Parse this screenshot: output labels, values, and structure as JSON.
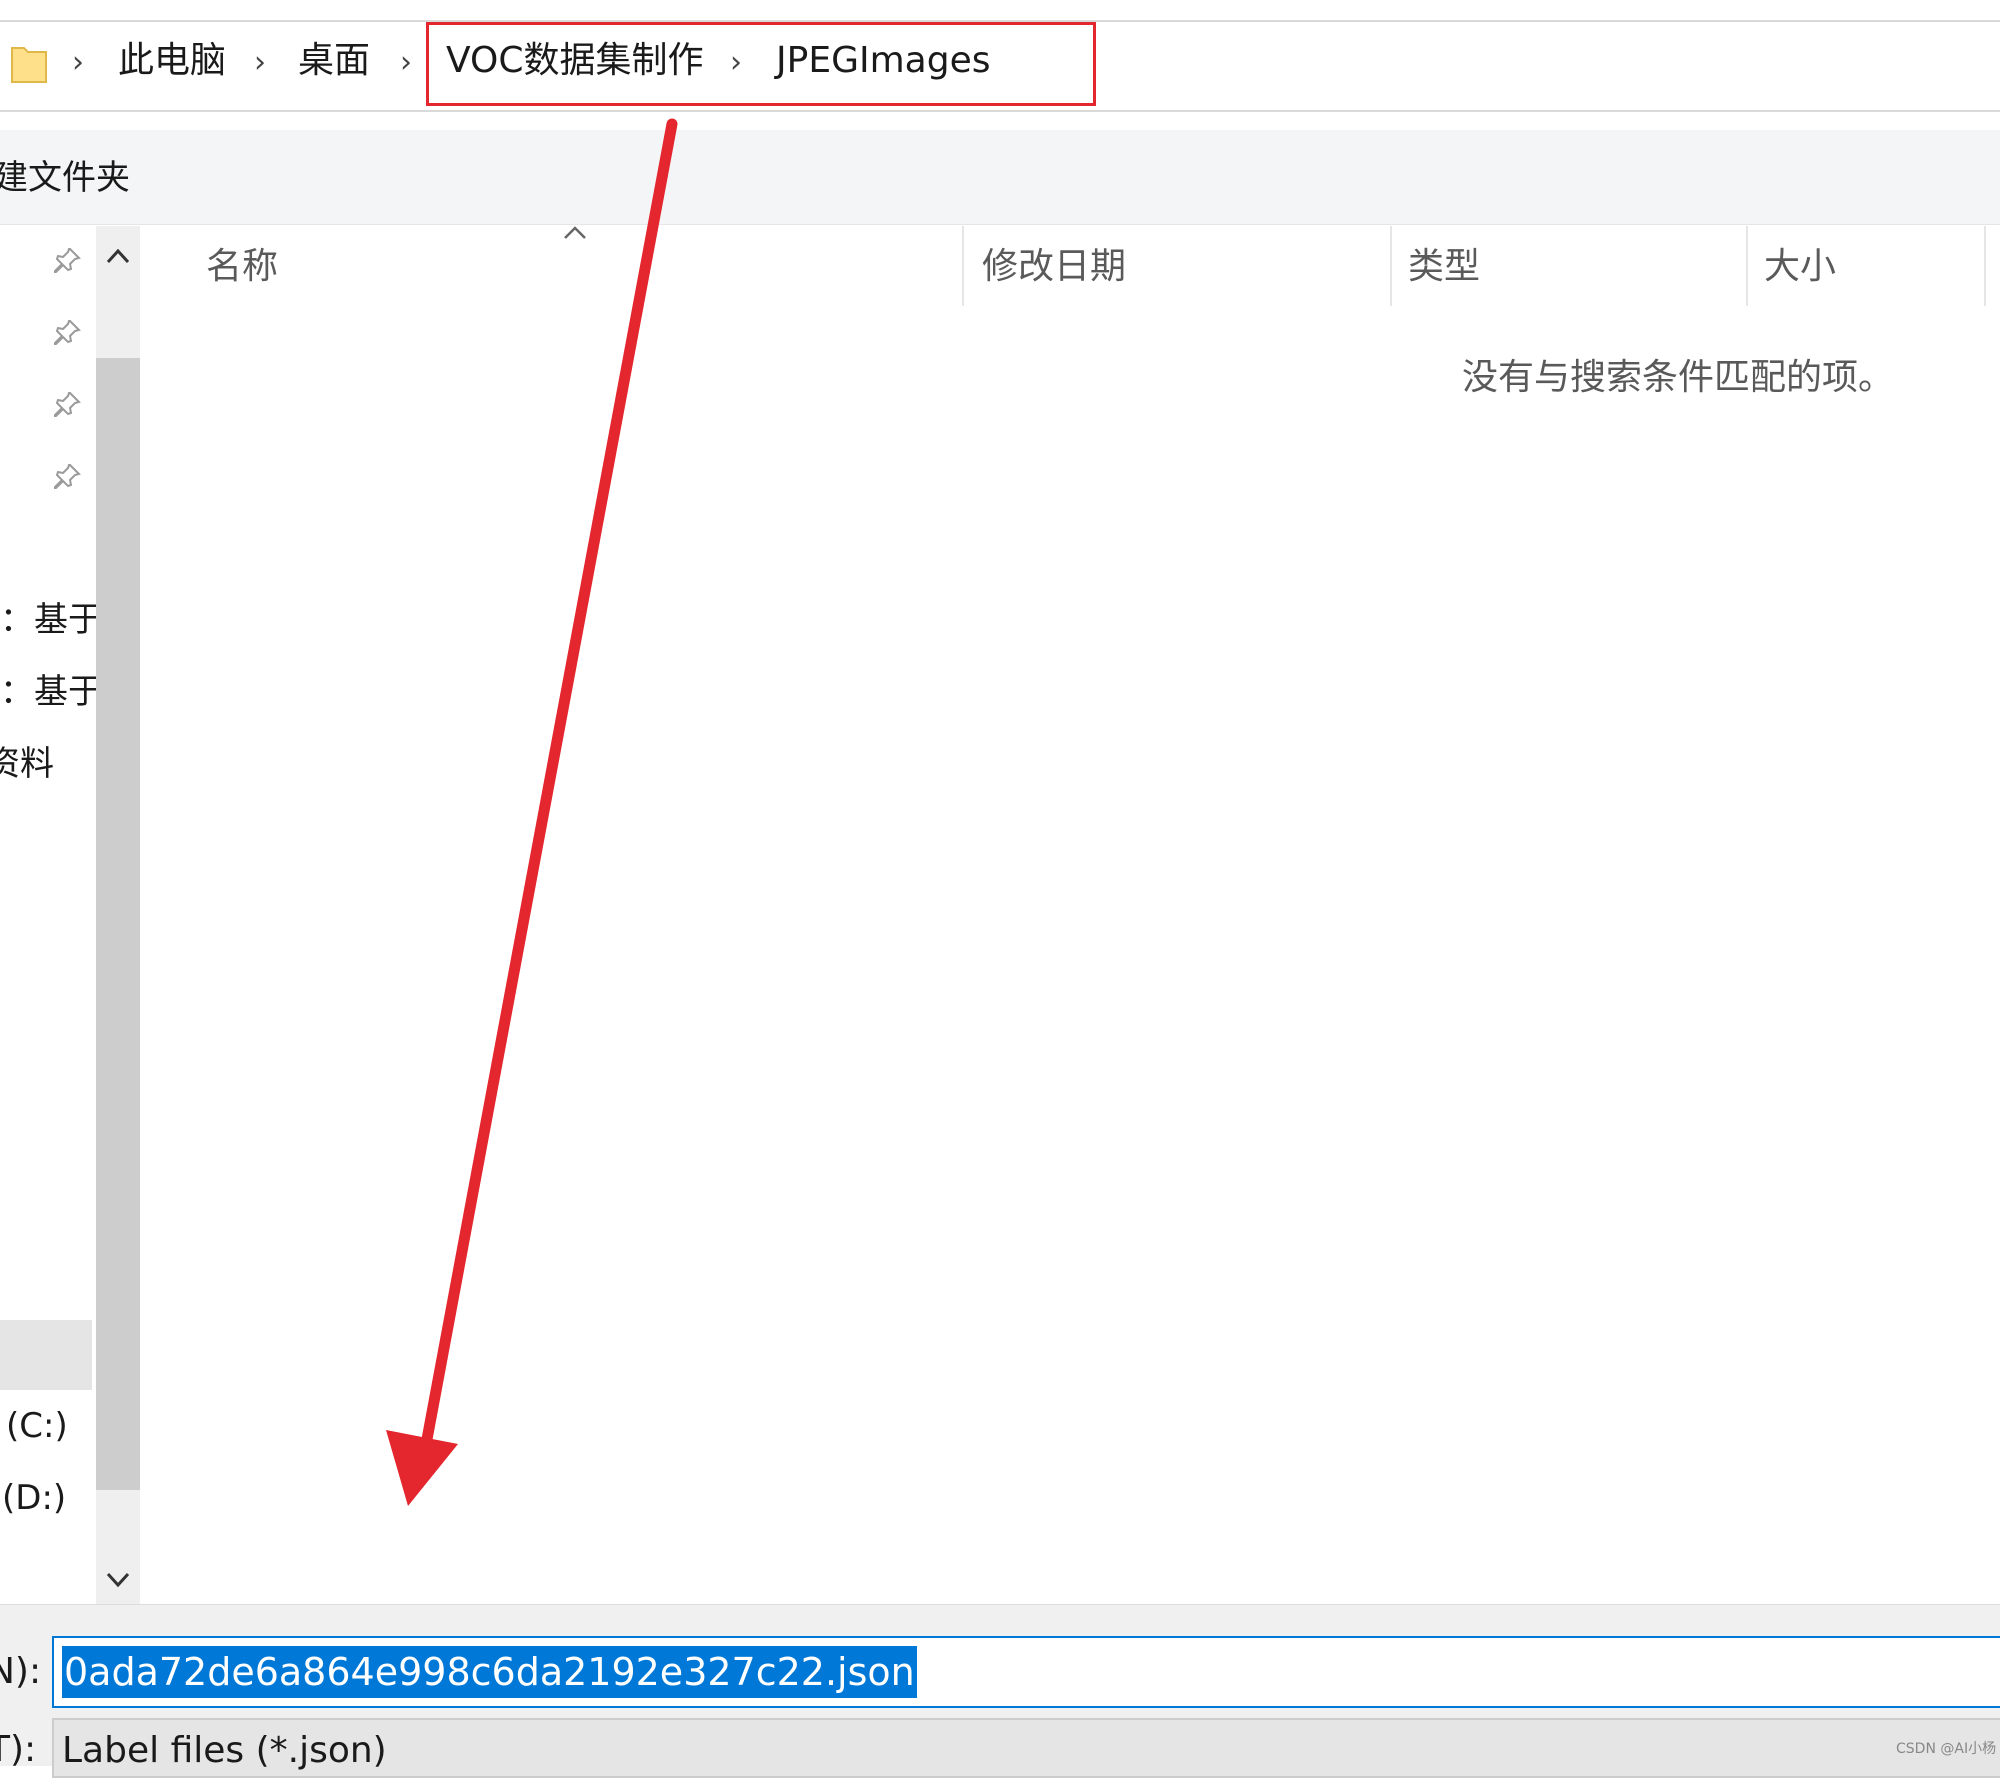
{
  "breadcrumb": {
    "items": [
      "此电脑",
      "桌面",
      "VOC数据集制作",
      "JPEGImages"
    ]
  },
  "toolbar": {
    "new_folder_label": "建文件夹"
  },
  "nav": {
    "items": [
      "：基于",
      "：基于",
      "资料"
    ],
    "drives": [
      "(C:)",
      "(D:)"
    ]
  },
  "filelist": {
    "columns": [
      "名称",
      "修改日期",
      "类型",
      "大小"
    ],
    "empty_message": "没有与搜索条件匹配的项。"
  },
  "form": {
    "filename_label": "N):",
    "filename_value": "0ada72de6a864e998c6da2192e327c22.json",
    "filetype_label": "T):",
    "filetype_value": "Label files (*.json)"
  },
  "annotation": {
    "highlight_color": "#e4262e",
    "arrow_color": "#e4262e"
  },
  "watermark": "CSDN @AI小杨",
  "icons": [
    "folder-icon",
    "chevron-right-icon",
    "pin-icon",
    "chevron-up-icon",
    "chevron-down-icon",
    "sort-ascending-icon"
  ]
}
